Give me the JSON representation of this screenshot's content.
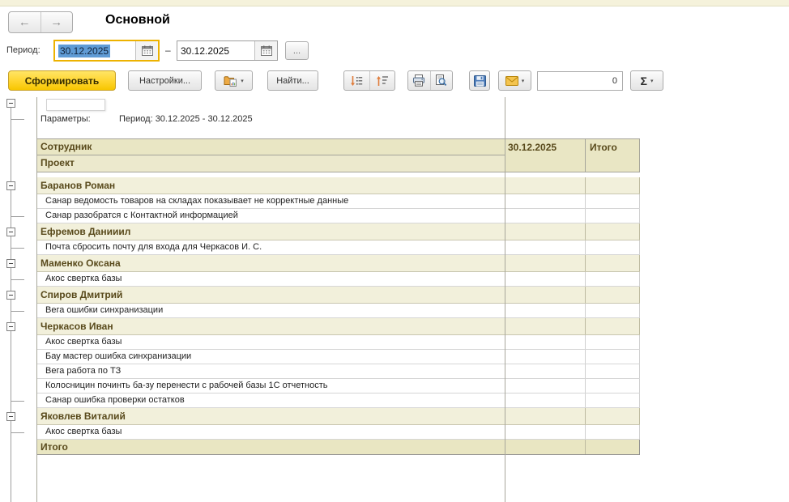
{
  "window": {
    "title": "Основной"
  },
  "icons": {
    "back": "←",
    "forward": "→",
    "dropdown": "▾",
    "sigma": "Σ",
    "dots": "...",
    "calendar": "calendar-icon",
    "folder_report": "folder-report-icon",
    "sort_desc": "sort-descending-icon",
    "sort_asc": "sort-ascending-icon",
    "printer": "printer-icon",
    "preview": "print-preview-icon",
    "save": "save-icon",
    "mail": "mail-icon"
  },
  "period": {
    "label": "Период:",
    "from": "30.12.2025",
    "separator": "–",
    "to": "30.12.2025"
  },
  "toolbar": {
    "generate": "Сформировать",
    "settings": "Настройки...",
    "find": "Найти...",
    "counter": "0"
  },
  "report": {
    "params_label": "Параметры:",
    "params_value": "Период: 30.12.2025 - 30.12.2025",
    "col_employee": "Сотрудник",
    "col_project": "Проект",
    "col_date": "30.12.2025",
    "col_total": "Итого",
    "total_label": "Итого",
    "groups": [
      {
        "name": "Баранов Роман",
        "projects": [
          "Санар ведомость товаров на складах показывает не корректные данные",
          "Санар разобратся с Контактной информацией"
        ]
      },
      {
        "name": "Ефремов Данииил",
        "projects": [
          "Почта сбросить почту для входа для Черкасов И. С."
        ]
      },
      {
        "name": "Маменко Оксана",
        "projects": [
          "Акос свертка базы"
        ]
      },
      {
        "name": "Спиров Дмитрий",
        "projects": [
          "Вега ошибки синхранизации"
        ]
      },
      {
        "name": "Черкасов Иван",
        "projects": [
          "Акос свертка базы",
          "Бау мастер ошибка синхранизации",
          "Вега работа по ТЗ",
          "Колосницин починть ба-зу перенести с рабочей базы 1С отчетность",
          "Санар ошибка проверки остатков"
        ]
      },
      {
        "name": "Яковлев Виталий",
        "projects": [
          "Акос свертка базы"
        ]
      }
    ]
  },
  "colors": {
    "accent_yellow": "#FFD633",
    "active_field_border": "#EDB200",
    "selection_blue": "#5F9BD5",
    "header_bg": "#E9E6C4",
    "group_bg": "#F2F0DB",
    "total_bg": "#E9E6C2",
    "report_text_brown": "#594A1C",
    "arrow_orange": "#E07B39"
  }
}
